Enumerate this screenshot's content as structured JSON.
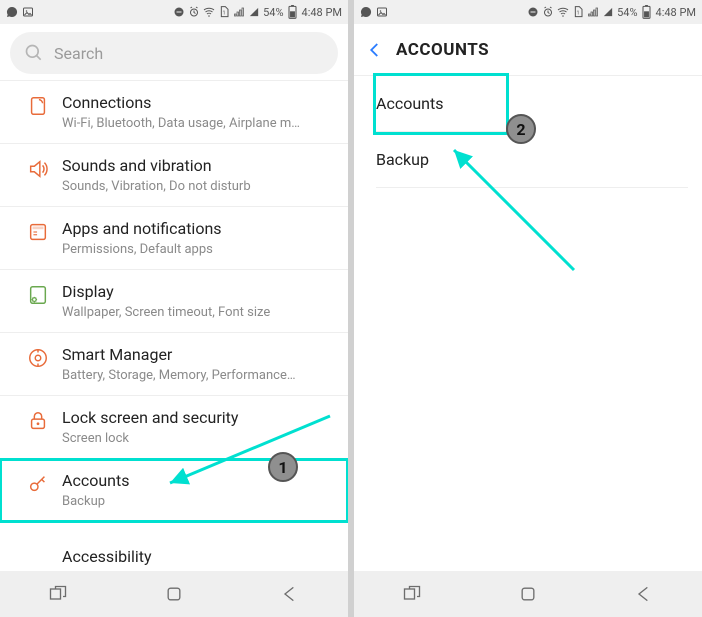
{
  "status": {
    "battery_pct": "54%",
    "time": "4:48 PM"
  },
  "left": {
    "search_placeholder": "Search",
    "items": [
      {
        "title": "Connections",
        "sub": "Wi-Fi, Bluetooth, Data usage, Airplane m…"
      },
      {
        "title": "Sounds and vibration",
        "sub": "Sounds, Vibration, Do not disturb"
      },
      {
        "title": "Apps and notifications",
        "sub": "Permissions, Default apps"
      },
      {
        "title": "Display",
        "sub": "Wallpaper, Screen timeout, Font size"
      },
      {
        "title": "Smart Manager",
        "sub": "Battery, Storage, Memory, Performance…"
      },
      {
        "title": "Lock screen and security",
        "sub": "Screen lock"
      },
      {
        "title": "Accounts",
        "sub": "Backup"
      }
    ],
    "partial_next": "Accessibility"
  },
  "right": {
    "header": "ACCOUNTS",
    "items": [
      {
        "label": "Accounts"
      },
      {
        "label": "Backup"
      }
    ]
  },
  "annotations": {
    "badge1": "1",
    "badge2": "2"
  }
}
